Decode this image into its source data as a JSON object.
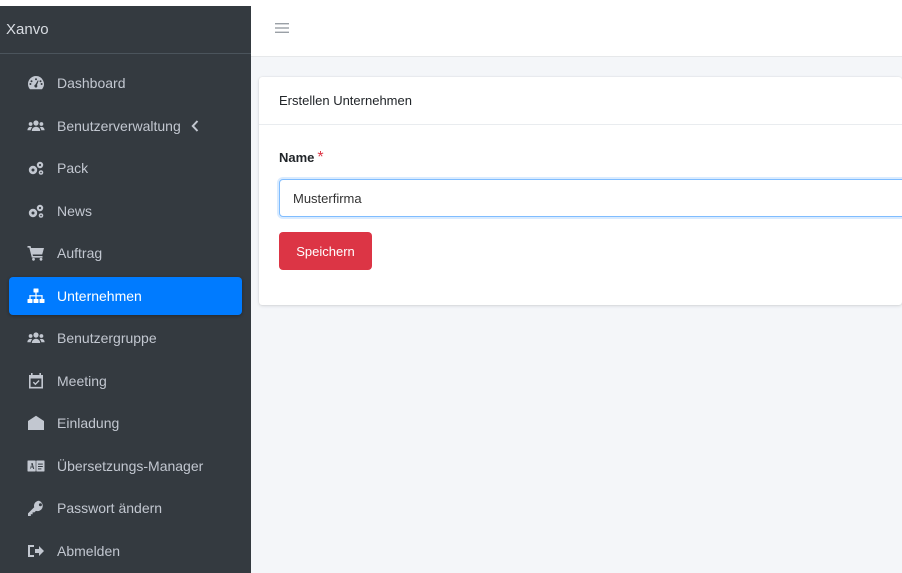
{
  "app": {
    "brand": "Xanvo"
  },
  "sidebar": {
    "items": [
      {
        "label": "Dashboard",
        "icon": "dashboard-icon",
        "active": false
      },
      {
        "label": "Benutzerverwaltung",
        "icon": "users-icon",
        "active": false,
        "has_children": true
      },
      {
        "label": "Pack",
        "icon": "cogs-icon",
        "active": false
      },
      {
        "label": "News",
        "icon": "cogs-icon",
        "active": false
      },
      {
        "label": "Auftrag",
        "icon": "cart-icon",
        "active": false
      },
      {
        "label": "Unternehmen",
        "icon": "sitemap-icon",
        "active": true
      },
      {
        "label": "Benutzergruppe",
        "icon": "users-icon",
        "active": false
      },
      {
        "label": "Meeting",
        "icon": "calendar-check-icon",
        "active": false
      },
      {
        "label": "Einladung",
        "icon": "envelope-open-icon",
        "active": false
      },
      {
        "label": "Übersetzungs-Manager",
        "icon": "language-icon",
        "active": false
      },
      {
        "label": "Passwort ändern",
        "icon": "key-icon",
        "active": false
      },
      {
        "label": "Abmelden",
        "icon": "sign-out-icon",
        "active": false
      }
    ]
  },
  "colors": {
    "sidebar_bg": "#343a40",
    "active_item": "#007bff",
    "save_button": "#dc3545",
    "required_marker": "#dc3545"
  },
  "main": {
    "card_title": "Erstellen Unternehmen",
    "form": {
      "name_label": "Name",
      "required_marker": "*",
      "name_value": "Musterfirma",
      "save_label": "Speichern"
    }
  }
}
